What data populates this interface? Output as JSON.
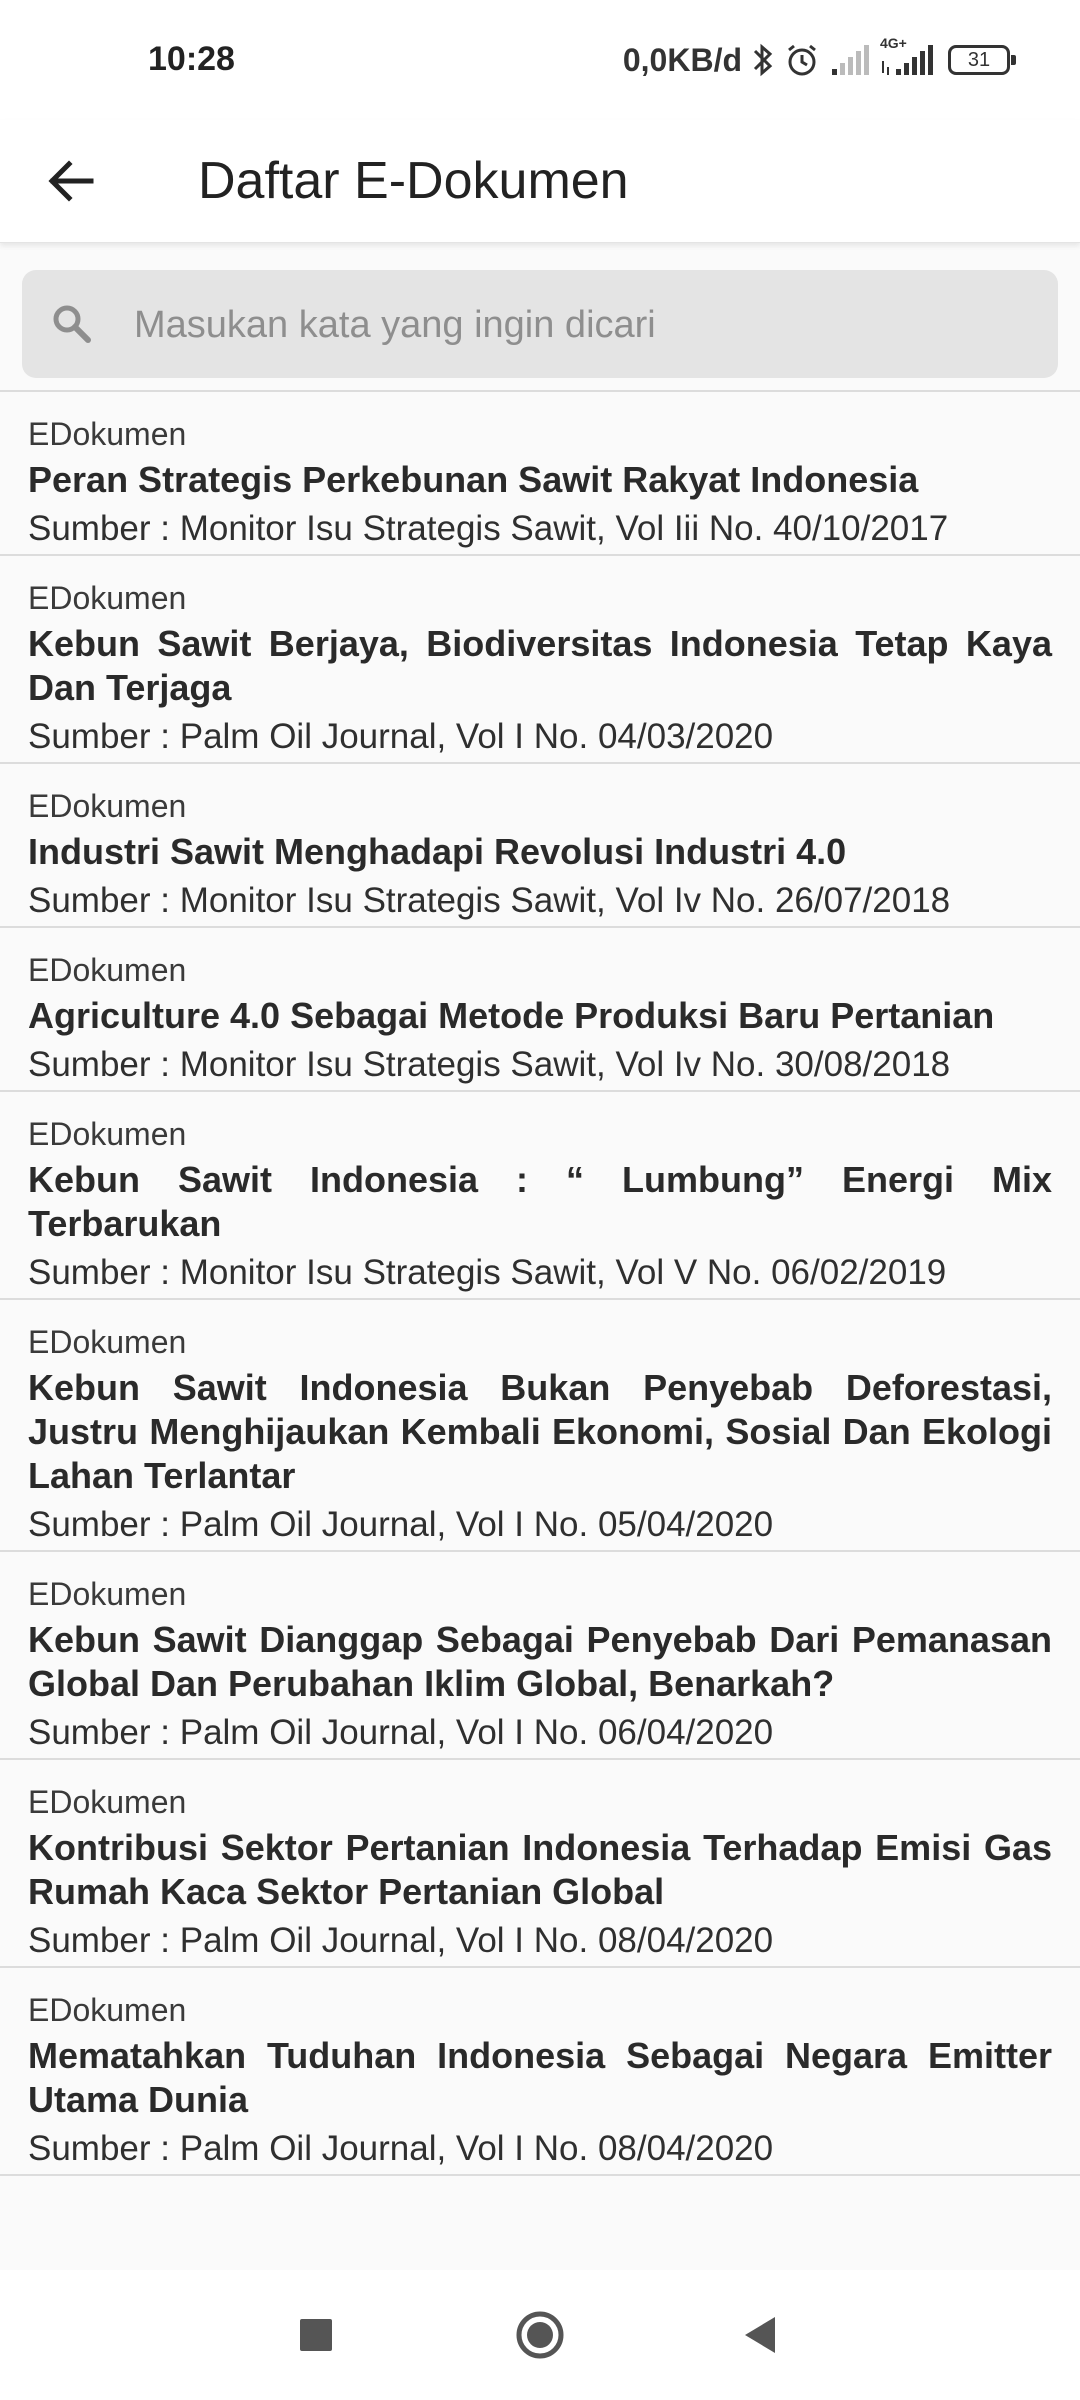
{
  "status_bar": {
    "time": "10:28",
    "net_speed": "0,0KB/d",
    "battery": "31",
    "network_label": "4G+"
  },
  "app_bar": {
    "title": "Daftar E-Dokumen",
    "back_icon": "arrow-left-icon"
  },
  "search": {
    "placeholder": "Masukan kata yang ingin dicari",
    "value": "",
    "icon": "search-icon"
  },
  "documents": [
    {
      "category": "EDokumen",
      "title": "Peran Strategis Perkebunan Sawit Rakyat Indonesia",
      "source": "Sumber : Monitor Isu Strategis Sawit, Vol Iii No. 40/10/2017"
    },
    {
      "category": "EDokumen",
      "title": "Kebun Sawit Berjaya, Biodiversitas Indonesia Tetap Kaya Dan Terjaga",
      "source": "Sumber : Palm Oil Journal, Vol I No. 04/03/2020"
    },
    {
      "category": "EDokumen",
      "title": "Industri Sawit Menghadapi Revolusi Industri 4.0",
      "source": "Sumber : Monitor Isu Strategis Sawit, Vol Iv No. 26/07/2018"
    },
    {
      "category": "EDokumen",
      "title": "Agriculture 4.0 Sebagai Metode Produksi Baru Pertanian",
      "source": "Sumber : Monitor Isu Strategis Sawit, Vol Iv No. 30/08/2018"
    },
    {
      "category": "EDokumen",
      "title": "Kebun Sawit Indonesia : “ Lumbung” Energi Mix Terbarukan",
      "source": "Sumber : Monitor Isu Strategis Sawit, Vol V No. 06/02/2019"
    },
    {
      "category": "EDokumen",
      "title": "Kebun Sawit Indonesia Bukan Penyebab Deforestasi, Justru Menghijaukan Kembali Ekonomi, Sosial Dan Ekologi Lahan Terlantar",
      "source": "Sumber : Palm Oil Journal, Vol I No. 05/04/2020"
    },
    {
      "category": "EDokumen",
      "title": "Kebun Sawit Dianggap Sebagai Penyebab Dari Pemanasan Global Dan Perubahan Iklim Global, Benarkah?",
      "source": "Sumber : Palm Oil Journal, Vol I No. 06/04/2020"
    },
    {
      "category": "EDokumen",
      "title": "Kontribusi Sektor Pertanian Indonesia Terhadap Emisi Gas Rumah Kaca Sektor Pertanian Global",
      "source": "Sumber : Palm Oil Journal, Vol I No. 08/04/2020"
    },
    {
      "category": "EDokumen",
      "title": "Mematahkan Tuduhan Indonesia Sebagai Negara Emitter Utama Dunia",
      "source": "Sumber : Palm Oil Journal, Vol I No. 08/04/2020"
    }
  ],
  "nav_bar": {
    "recents_icon": "square-recents-icon",
    "home_icon": "circle-home-icon",
    "back_icon": "triangle-back-icon"
  },
  "colors": {
    "background": "#fafafa",
    "appbar": "#ffffff",
    "search_field": "#e4e4e4",
    "divider": "#dcdcdc",
    "text": "#212121"
  }
}
